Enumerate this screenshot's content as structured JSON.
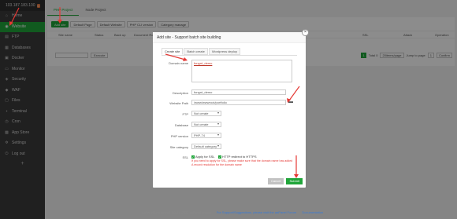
{
  "sidebar": {
    "ip": "103.187.183.100",
    "badge": "0",
    "items": [
      {
        "label": "Home",
        "icon": "home-icon",
        "glyph": "⌂"
      },
      {
        "label": "Website",
        "icon": "globe-icon",
        "glyph": "◉"
      },
      {
        "label": "FTP",
        "icon": "ftp-icon",
        "glyph": "▤"
      },
      {
        "label": "Databases",
        "icon": "database-icon",
        "glyph": "▦"
      },
      {
        "label": "Docker",
        "icon": "docker-icon",
        "glyph": "▣"
      },
      {
        "label": "Monitor",
        "icon": "monitor-icon",
        "glyph": "▭"
      },
      {
        "label": "Security",
        "icon": "shield-icon",
        "glyph": "◈"
      },
      {
        "label": "WAF",
        "icon": "waf-icon",
        "glyph": "◆"
      },
      {
        "label": "Files",
        "icon": "folder-icon",
        "glyph": "▢"
      },
      {
        "label": "Terminal",
        "icon": "terminal-icon",
        "glyph": "▪"
      },
      {
        "label": "Cron",
        "icon": "clock-icon",
        "glyph": "◷"
      },
      {
        "label": "App Store",
        "icon": "store-icon",
        "glyph": "▩"
      },
      {
        "label": "Settings",
        "icon": "gear-icon",
        "glyph": "✲"
      },
      {
        "label": "Log out",
        "icon": "logout-icon",
        "glyph": "⏻"
      }
    ],
    "plus": "+"
  },
  "tabs": [
    "PHP Project",
    "Node Project"
  ],
  "toolbar": [
    "Add site",
    "Default Page",
    "Default Website",
    "PHP CLI version",
    "Category manage"
  ],
  "table_headers": [
    "Site name",
    "Status",
    "Back up",
    "Document Root",
    "SSL",
    "Attack",
    "Operation"
  ],
  "table_footer": {
    "exec": "Execute",
    "page": "1",
    "total": "Total 0",
    "per_page": "20items/page",
    "jump_to": "Jump to page",
    "page_input": "1",
    "confirm": "Confirm"
  },
  "footer": {
    "copyright": "aaPanel Linux panel ©2014-2022 aaPanel (bt.cn)",
    "support": "For Support/Suggestions, please visit the aaPanel Forum",
    "docs": "Documentation"
  },
  "modal": {
    "title": "Add site - Support batch site building",
    "tabs": [
      "Create site",
      "Batch create",
      "Wordpress deploy"
    ],
    "domain_label": "Domain name",
    "domain_value": "fongnt_demo",
    "description_label": "Description",
    "description_value": "fongnt_demo",
    "path_label": "Website Path",
    "path_value": "/www/wwwroot/portfolio",
    "ftp_label": "FTP",
    "ftp_value": "Not create",
    "db_label": "Database",
    "db_value": "Not create",
    "php_label": "PHP version",
    "php_value": "PHP-74",
    "cat_label": "Site category",
    "cat_value": "Default category",
    "ssl_label": "SSL",
    "ssl_apply": "Apply for SSL",
    "ssl_redirect": "HTTP redirect to HTTPS",
    "ssl_note": "If you need to apply for SSL, please make sure that the domain name has added A record resolution for the domain name",
    "cancel": "Cancel",
    "submit": "Submit"
  },
  "colors": {
    "accent": "#20a53a",
    "annotation": "#e53935",
    "sidebar": "#3b3b3b"
  }
}
